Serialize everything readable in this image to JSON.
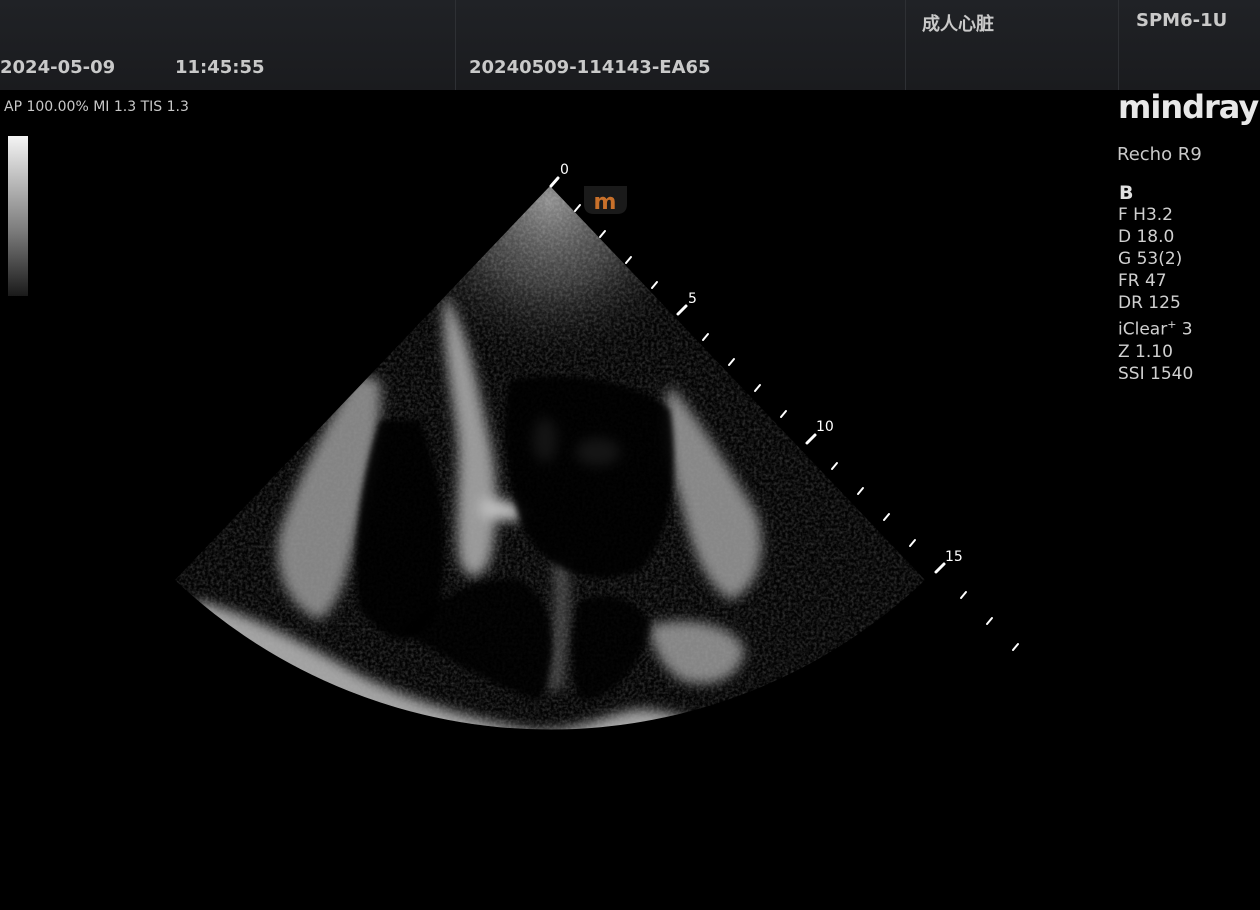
{
  "header": {
    "date": "2024-05-09",
    "time": "11:45:55",
    "patient_id": "20240509-114143-EA65",
    "exam_preset": "成人心脏",
    "probe": "SPM6-1U"
  },
  "status": {
    "power_line": "AP 100.00%  MI 1.3 TIS 1.3"
  },
  "brand": {
    "logo": "mindray",
    "model": "Recho R9"
  },
  "imaging": {
    "mode": "B",
    "orientation_marker": "m",
    "params": {
      "frequency": "F H3.2",
      "depth": "D 18.0",
      "gain": "G 53(2)",
      "frame_rate": "FR 47",
      "dynamic_range": "DR 125",
      "iclear_base": "iClear",
      "iclear_sup": "+",
      "iclear_value": " 3",
      "zoom": "Z 1.10",
      "ssi": "SSI 1540"
    },
    "depth_scale": {
      "label_0": "0",
      "label_5": "5",
      "label_10": "10",
      "label_15": "15"
    }
  },
  "colors": {
    "orientation_marker": "#c8702a",
    "header_bg": "#1e2024"
  }
}
